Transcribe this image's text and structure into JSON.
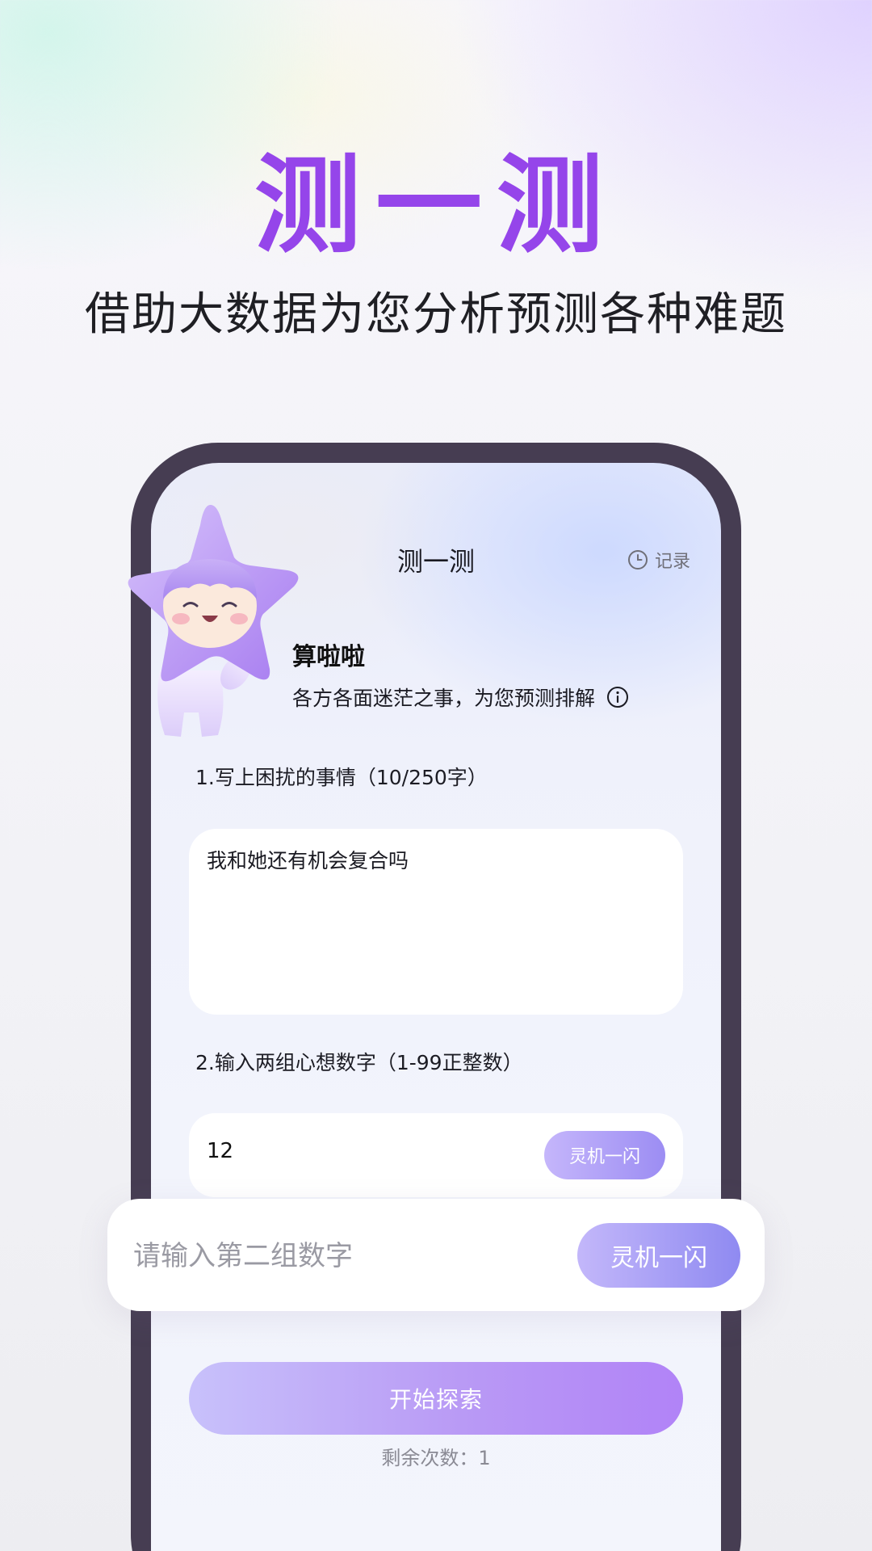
{
  "hero": {
    "title": "测一测",
    "subtitle": "借助大数据为您分析预测各种难题"
  },
  "screen": {
    "title": "测一测",
    "record_label": "记录",
    "app_name": "算啦啦",
    "app_desc": "各方各面迷茫之事，为您预测排解",
    "field1_label": "1.写上困扰的事情（10/250字）",
    "field1_value": "我和她还有机会复合吗",
    "field2_label": "2.输入两组心想数字（1-99正整数）",
    "field2_value": "12",
    "inspire_label": "灵机一闪",
    "start_label": "开始探索",
    "remaining_text": "剩余次数：1"
  },
  "float_card": {
    "placeholder": "请输入第二组数字",
    "inspire_label": "灵机一闪"
  },
  "icons": {
    "clock": "clock-icon",
    "info": "info-icon",
    "mascot": "star-mascot"
  },
  "colors": {
    "title_purple": "#9545ea",
    "frame": "#463d52",
    "button_start": "#c8c1fb",
    "button_end": "#b183f7"
  }
}
